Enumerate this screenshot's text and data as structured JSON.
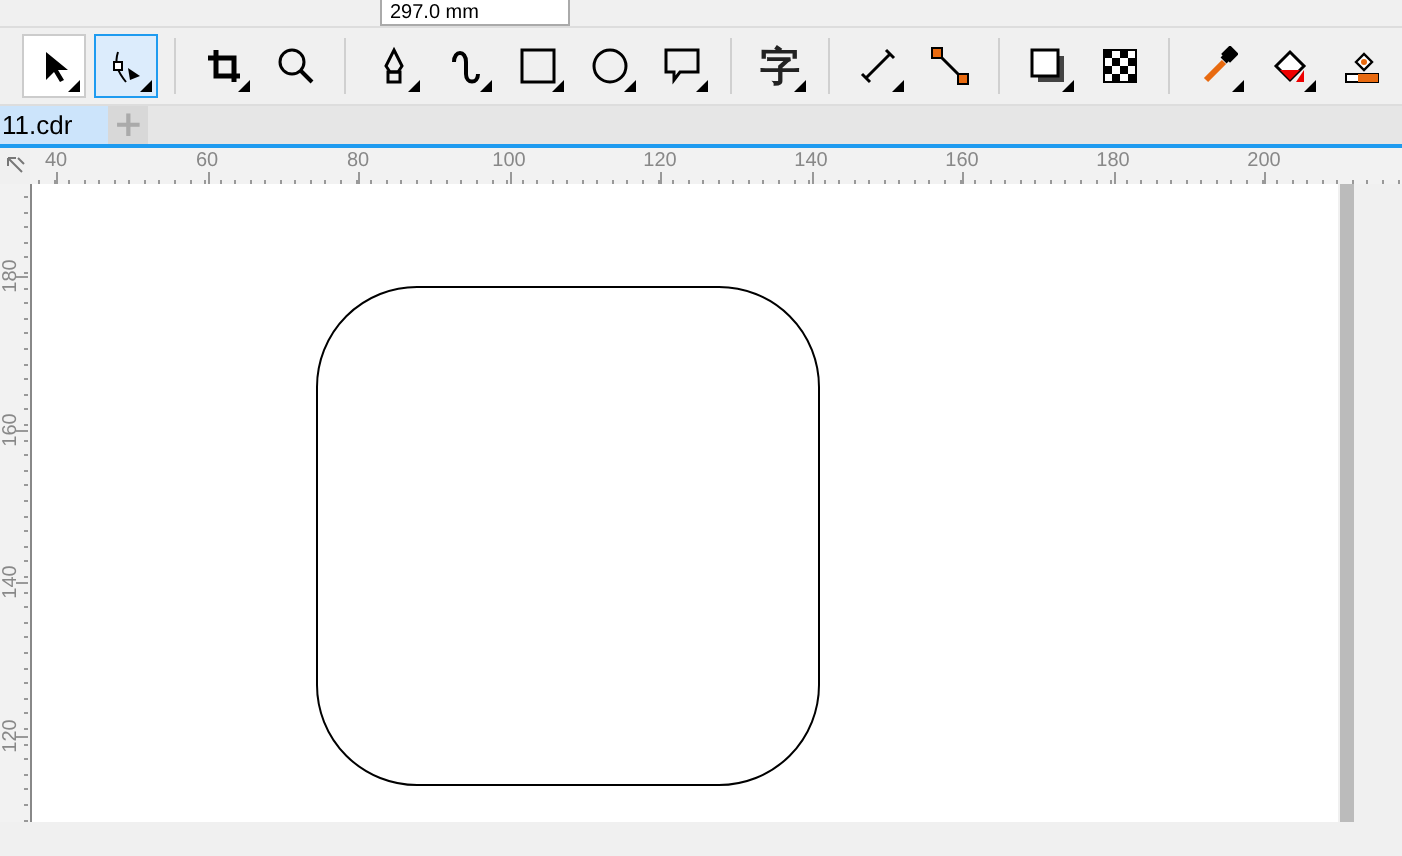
{
  "property_bar": {
    "height_field": {
      "value": "297.0 mm"
    }
  },
  "toolbar": {
    "groups": [
      [
        {
          "kind": "pick",
          "selected": false
        },
        {
          "kind": "shape",
          "selected": true
        }
      ],
      [
        {
          "kind": "crop",
          "selected": false
        },
        {
          "kind": "zoom",
          "selected": false
        }
      ],
      [
        {
          "kind": "pen",
          "selected": false
        },
        {
          "kind": "curve",
          "selected": false
        },
        {
          "kind": "rectangle",
          "selected": false
        },
        {
          "kind": "ellipse",
          "selected": false
        },
        {
          "kind": "callout",
          "selected": false
        }
      ],
      [
        {
          "kind": "text",
          "glyph": "字",
          "selected": false
        }
      ],
      [
        {
          "kind": "dimension",
          "selected": false
        },
        {
          "kind": "connector",
          "selected": false
        }
      ],
      [
        {
          "kind": "shadow",
          "selected": false
        },
        {
          "kind": "transparency",
          "selected": false
        }
      ],
      [
        {
          "kind": "eyedropper",
          "selected": false
        },
        {
          "kind": "fill",
          "selected": false
        },
        {
          "kind": "smart_fill",
          "selected": false
        }
      ]
    ]
  },
  "tabs": [
    {
      "label": "11.cdr",
      "selected": true
    }
  ],
  "new_tab_button": "+",
  "horizontal_ruler": [
    "40",
    "60",
    "80",
    "100",
    "120",
    "140",
    "160",
    "180",
    "200"
  ],
  "vertical_ruler": [
    "180",
    "160",
    "140",
    "120"
  ]
}
